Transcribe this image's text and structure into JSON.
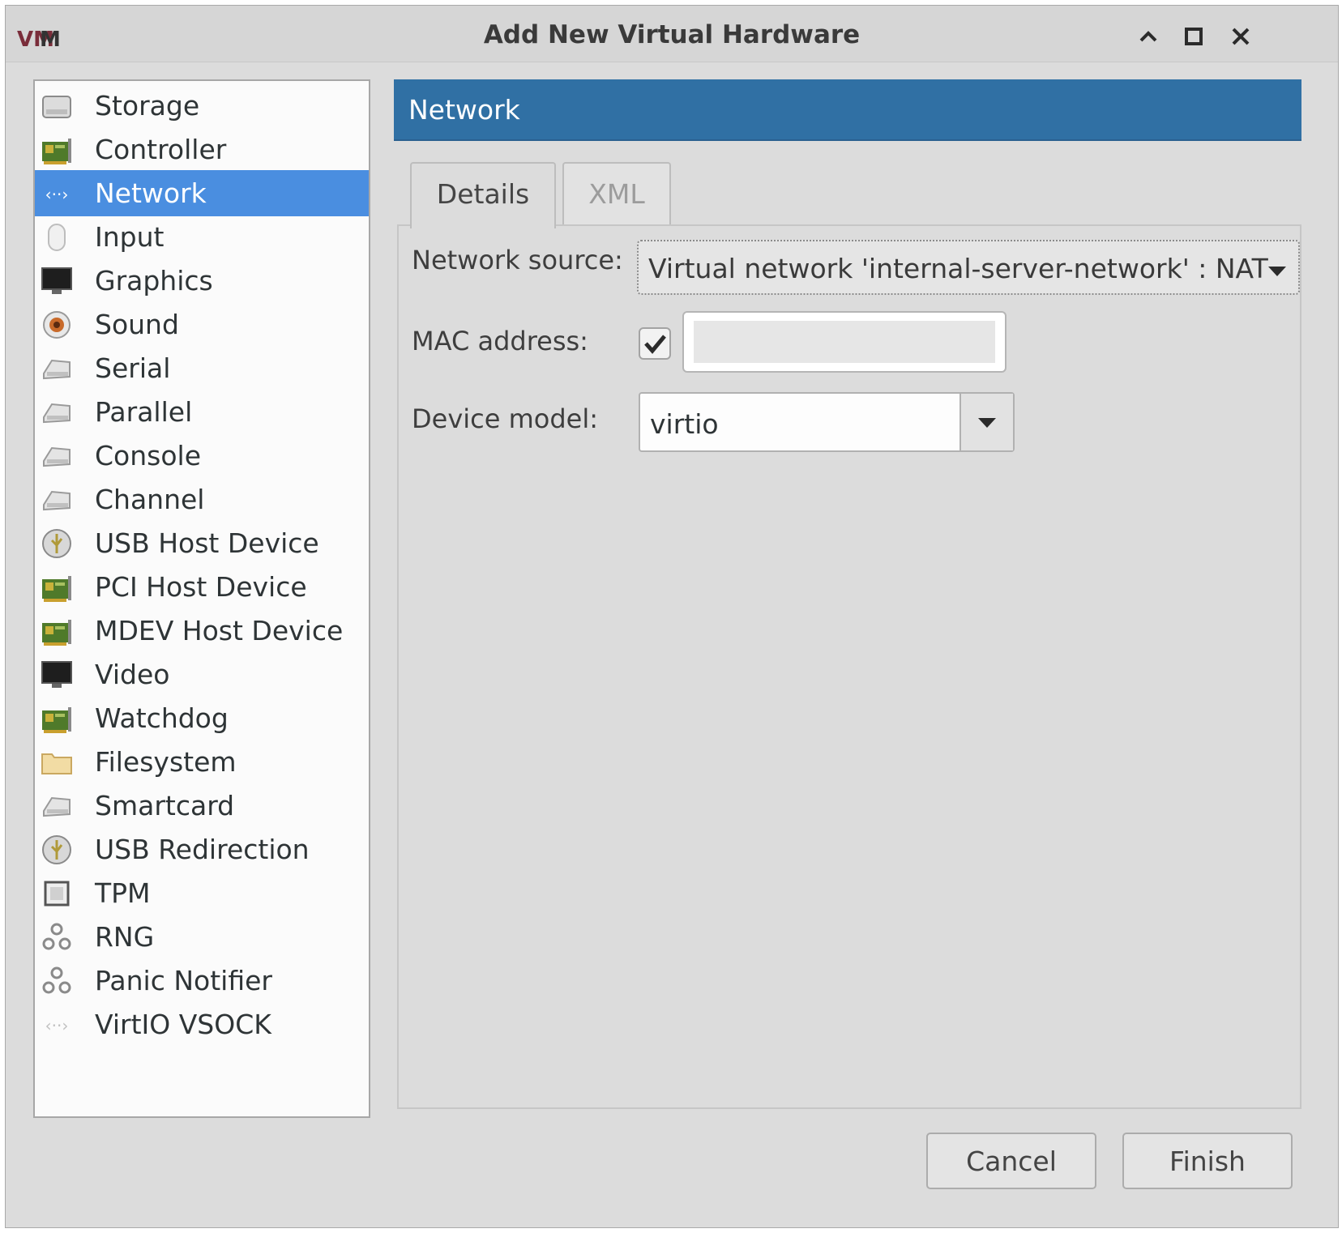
{
  "window": {
    "title": "Add New Virtual Hardware",
    "logo_text": "VM"
  },
  "device_list": [
    {
      "label": "Storage",
      "icon": "disk-icon"
    },
    {
      "label": "Controller",
      "icon": "card-icon"
    },
    {
      "label": "Network",
      "icon": "network-icon",
      "selected": true
    },
    {
      "label": "Input",
      "icon": "mouse-icon"
    },
    {
      "label": "Graphics",
      "icon": "monitor-icon"
    },
    {
      "label": "Sound",
      "icon": "speaker-icon"
    },
    {
      "label": "Serial",
      "icon": "port-icon"
    },
    {
      "label": "Parallel",
      "icon": "port-icon"
    },
    {
      "label": "Console",
      "icon": "port-icon"
    },
    {
      "label": "Channel",
      "icon": "port-icon"
    },
    {
      "label": "USB Host Device",
      "icon": "usb-icon"
    },
    {
      "label": "PCI Host Device",
      "icon": "card-icon"
    },
    {
      "label": "MDEV Host Device",
      "icon": "card-icon"
    },
    {
      "label": "Video",
      "icon": "monitor-icon"
    },
    {
      "label": "Watchdog",
      "icon": "card-icon"
    },
    {
      "label": "Filesystem",
      "icon": "folder-icon"
    },
    {
      "label": "Smartcard",
      "icon": "port-icon"
    },
    {
      "label": "USB Redirection",
      "icon": "usb-icon"
    },
    {
      "label": "TPM",
      "icon": "chip-icon"
    },
    {
      "label": "RNG",
      "icon": "gears-icon"
    },
    {
      "label": "Panic Notifier",
      "icon": "gears-icon"
    },
    {
      "label": "VirtIO VSOCK",
      "icon": "vsock-icon"
    }
  ],
  "panel": {
    "header": "Network",
    "tabs": [
      {
        "label": "Details",
        "active": true
      },
      {
        "label": "XML",
        "active": false
      }
    ],
    "network_source_label": "Network source:",
    "network_source_value": "Virtual network 'internal-server-network' : NAT",
    "mac_label": "MAC address:",
    "mac_checked": true,
    "mac_value": "",
    "device_model_label": "Device model:",
    "device_model_value": "virtio"
  },
  "buttons": {
    "cancel": "Cancel",
    "finish": "Finish"
  },
  "colors": {
    "selection": "#4a8ee0",
    "header": "#3070a4"
  }
}
